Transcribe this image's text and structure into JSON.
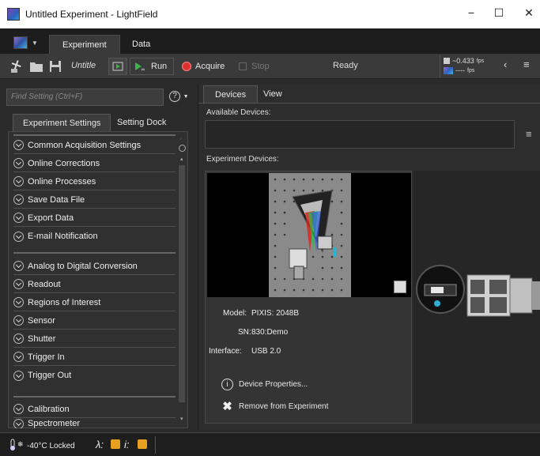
{
  "window": {
    "title": "Untitled Experiment - LightField",
    "minimize": "−",
    "maximize": "☐",
    "close": "✕"
  },
  "ribbon": {
    "tabs": [
      {
        "label": "Experiment"
      },
      {
        "label": "Data"
      }
    ]
  },
  "toolbar": {
    "experiment_name": "Untitle",
    "run_label": "Run",
    "acquire_label": "Acquire",
    "stop_label": "Stop",
    "status": "Ready",
    "fps_primary": "~0.433",
    "fps_unit": "fps",
    "fps_secondary": "----",
    "fps_secondary_unit": "fps",
    "colors": {
      "run": "#3bb54a",
      "acquire": "#e03030"
    }
  },
  "left_panel": {
    "search_placeholder": "Find Setting (Ctrl+F)",
    "help_glyph": "?",
    "tabs": [
      "Experiment Settings",
      "Setting Dock"
    ],
    "groups": [
      [
        "Common Acquisition Settings",
        "Online Corrections",
        "Online Processes",
        "Save Data File",
        "Export Data",
        "E-mail Notification"
      ],
      [
        "Analog to Digital Conversion",
        "Readout",
        "Regions of Interest",
        "Sensor",
        "Shutter",
        "Trigger In",
        "Trigger Out"
      ],
      [
        "Calibration",
        "Spectrometer"
      ]
    ]
  },
  "devices_panel": {
    "tabs": [
      "Devices",
      "View"
    ],
    "available_label": "Available Devices:",
    "experiment_label": "Experiment Devices:",
    "model_label": "Model:",
    "model_value": "PIXIS: 2048B",
    "sn_label": "SN:",
    "sn_value": "830:Demo",
    "interface_label": "Interface:",
    "interface_value": "USB 2.0",
    "device_properties": "Device Properties...",
    "remove": "Remove from Experiment"
  },
  "statusbar": {
    "temperature": "-40°C Locked",
    "lambda": "λ:",
    "intensity": "i:",
    "warning_color": "#e8a020"
  }
}
